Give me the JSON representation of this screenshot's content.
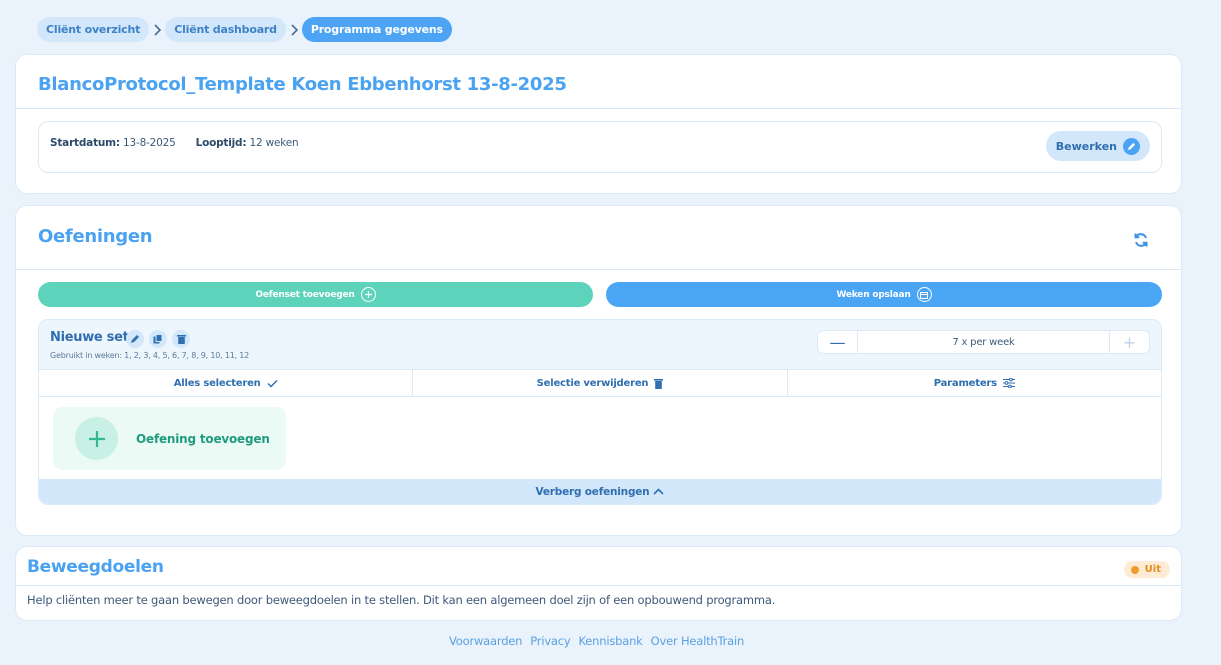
{
  "breadcrumb": {
    "items": [
      "Cliënt overzicht",
      "Cliënt dashboard",
      "Programma gegevens"
    ]
  },
  "program": {
    "title": "BlancoProtocol_Template Koen Ebbenhorst 13-8-2025",
    "start_label": "Startdatum:",
    "start_value": "13-8-2025",
    "duration_label": "Looptijd:",
    "duration_value": "12 weken",
    "edit_label": "Bewerken"
  },
  "exercises": {
    "title": "Oefeningen",
    "add_set_label": "Oefenset toevoegen",
    "save_weeks_label": "Weken opslaan",
    "set": {
      "name": "Nieuwe set",
      "used_in": "Gebruikt in weken: 1, 2, 3, 4, 5, 6, 7, 8, 9, 10, 11, 12",
      "frequency": "7 x per week",
      "minus": "—",
      "plus": "+",
      "select_all": "Alles selecteren",
      "delete_selection": "Selectie verwijderen",
      "parameters": "Parameters",
      "add_exercise": "Oefening toevoegen",
      "hide_exercises": "Verberg oefeningen"
    }
  },
  "goals": {
    "title": "Beweegdoelen",
    "status": "Uit",
    "description": "Help cliënten meer te gaan bewegen door beweegdoelen in te stellen. Dit kan een algemeen doel zijn of een opbouwend programma."
  },
  "footer": {
    "links": [
      "Voorwaarden",
      "Privacy",
      "Kennisbank",
      "Over HealthTrain"
    ]
  },
  "colors": {
    "accent": "#4ba2f0",
    "green": "#5dd3bc",
    "background": "#eaf3fc",
    "status_off": "#f29a2e"
  }
}
